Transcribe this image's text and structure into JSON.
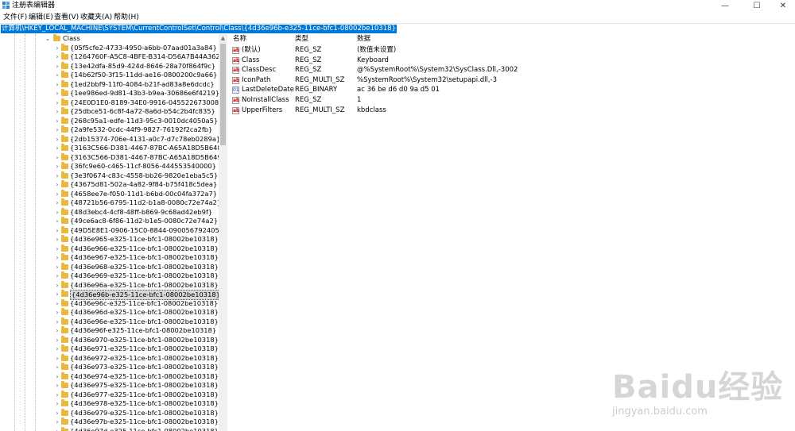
{
  "window": {
    "title": "注册表编辑器",
    "minimize": "—",
    "maximize": "☐",
    "close": "✕"
  },
  "menu": [
    "文件(F)",
    "编辑(E)",
    "查看(V)",
    "收藏夹(A)",
    "帮助(H)"
  ],
  "address": "计算机\\HKEY_LOCAL_MACHINE\\SYSTEM\\CurrentControlSet\\Control\\Class\\{4d36e96b-e325-11ce-bfc1-08002be10318}",
  "tree": {
    "parent": "Class",
    "children": [
      "{05f5cfe2-4733-4950-a6bb-07aad01a3a84}",
      "{1264760F-A5C8-4BFE-B314-D56A7B44A362}",
      "{13e42dfa-85d9-424d-8646-28a70f864f9c}",
      "{14b62f50-3f15-11dd-ae16-0800200c9a66}",
      "{1ed2bbf9-11f0-4084-b21f-ad83a8e6dcdc}",
      "{1ee986ed-9d81-43b3-b9ea-30686e6f4219}",
      "{24E0D1E0-8189-34E0-9916-045522673008}",
      "{25dbce51-6c8f-4a72-8a6d-b54c2b4fc835}",
      "{268c95a1-edfe-11d3-95c3-0010dc4050a5}",
      "{2a9fe532-0cdc-44f9-9827-76192f2ca2fb}",
      "{2db15374-706e-4131-a0c7-d7c78eb0289a}",
      "{3163C566-D381-4467-87BC-A65A18D5B648}",
      "{3163C566-D381-4467-87BC-A65A18D5B649}",
      "{36fc9e60-c465-11cf-8056-444553540000}",
      "{3e3f0674-c83c-4558-bb26-9820e1eba5c5}",
      "{43675d81-502a-4a82-9f84-b75f418c5dea}",
      "{4658ee7e-f050-11d1-b6bd-00c04fa372a7}",
      "{48721b56-6795-11d2-b1a8-0080c72e74a2}",
      "{48d3ebc4-4cf8-48ff-b869-9c68ad42eb9f}",
      "{49ce6ac8-6f86-11d2-b1e5-0080c72e74a2}",
      "{49D5E8E1-0906-15C0-8844-090056792405}",
      "{4d36e965-e325-11ce-bfc1-08002be10318}",
      "{4d36e966-e325-11ce-bfc1-08002be10318}",
      "{4d36e967-e325-11ce-bfc1-08002be10318}",
      "{4d36e968-e325-11ce-bfc1-08002be10318}",
      "{4d36e969-e325-11ce-bfc1-08002be10318}",
      "{4d36e96a-e325-11ce-bfc1-08002be10318}",
      "{4d36e96b-e325-11ce-bfc1-08002be10318}",
      "{4d36e96c-e325-11ce-bfc1-08002be10318}",
      "{4d36e96d-e325-11ce-bfc1-08002be10318}",
      "{4d36e96e-e325-11ce-bfc1-08002be10318}",
      "{4d36e96f-e325-11ce-bfc1-08002be10318}",
      "{4d36e970-e325-11ce-bfc1-08002be10318}",
      "{4d36e971-e325-11ce-bfc1-08002be10318}",
      "{4d36e972-e325-11ce-bfc1-08002be10318}",
      "{4d36e973-e325-11ce-bfc1-08002be10318}",
      "{4d36e974-e325-11ce-bfc1-08002be10318}",
      "{4d36e975-e325-11ce-bfc1-08002be10318}",
      "{4d36e977-e325-11ce-bfc1-08002be10318}",
      "{4d36e978-e325-11ce-bfc1-08002be10318}",
      "{4d36e979-e325-11ce-bfc1-08002be10318}",
      "{4d36e97b-e325-11ce-bfc1-08002be10318}",
      "{4d36e97d-e325-11ce-bfc1-08002be10318}"
    ],
    "selected": "{4d36e96b-e325-11ce-bfc1-08002be10318}"
  },
  "values": {
    "headers": {
      "name": "名称",
      "type": "类型",
      "data": "数据"
    },
    "rows": [
      {
        "icon": "ab",
        "name": "(默认)",
        "type": "REG_SZ",
        "data": "(数值未设置)"
      },
      {
        "icon": "ab",
        "name": "Class",
        "type": "REG_SZ",
        "data": "Keyboard"
      },
      {
        "icon": "ab",
        "name": "ClassDesc",
        "type": "REG_SZ",
        "data": "@%SystemRoot%\\System32\\SysClass.Dll,-3002"
      },
      {
        "icon": "ab",
        "name": "IconPath",
        "type": "REG_MULTI_SZ",
        "data": "%SystemRoot%\\System32\\setupapi.dll,-3"
      },
      {
        "icon": "bin",
        "name": "LastDeleteDate",
        "type": "REG_BINARY",
        "data": "ac 36 be d6 d0 9a d5 01"
      },
      {
        "icon": "ab",
        "name": "NoInstallClass",
        "type": "REG_SZ",
        "data": "1"
      },
      {
        "icon": "ab",
        "name": "UpperFilters",
        "type": "REG_MULTI_SZ",
        "data": "kbdclass"
      }
    ]
  },
  "watermark": {
    "brand": "Baidu经验",
    "url": "jingyan.baidu.com"
  },
  "colors": {
    "selection": "#0078d7",
    "folder": "#e8b93c"
  }
}
